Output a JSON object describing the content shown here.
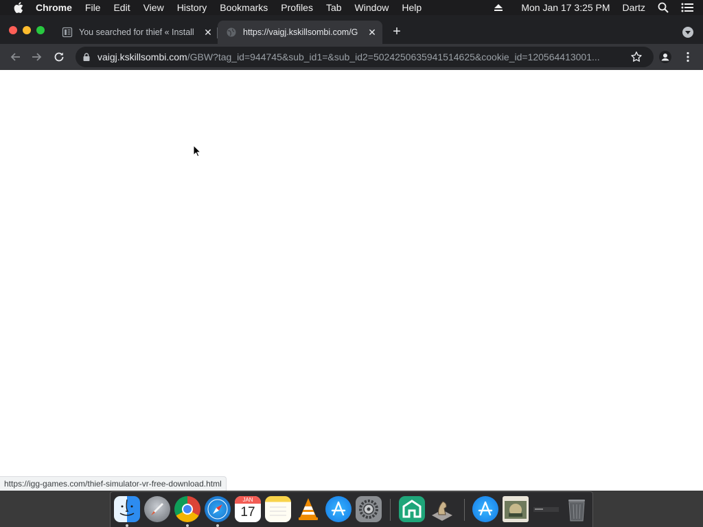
{
  "menubar": {
    "app_name": "Chrome",
    "items": [
      "File",
      "Edit",
      "View",
      "History",
      "Bookmarks",
      "Profiles",
      "Tab",
      "Window",
      "Help"
    ],
    "datetime": "Mon Jan 17  3:25 PM",
    "user": "Dartz"
  },
  "tabs": [
    {
      "title": "You searched for thief « Install",
      "active": false,
      "favicon": "page-icon"
    },
    {
      "title": "https://vaigj.kskillsombi.com/G",
      "active": true,
      "favicon": "globe-icon"
    }
  ],
  "toolbar": {
    "url_host": "vaigj.kskillsombi.com",
    "url_path": "/GBW?tag_id=944745&sub_id1=&sub_id2=5024250635941514625&cookie_id=120564413001..."
  },
  "status_bar": {
    "link": "https://igg-games.com/thief-simulator-vr-free-download.html"
  },
  "dock": {
    "apps": [
      "finder-icon",
      "launchpad-icon",
      "chrome-icon",
      "safari-icon",
      "calendar-icon",
      "notes-icon",
      "vlc-icon",
      "app-store-icon",
      "system-preferences-icon",
      "home-app-icon",
      "chess-icon",
      "app-store-2-icon",
      "photo-icon",
      "minimized-window-icon",
      "trash-icon"
    ],
    "calendar_month": "JAN",
    "calendar_day": "17"
  },
  "colors": {
    "menubar": "#1c1c1e",
    "tabstrip": "#202124",
    "toolbar": "#35363a",
    "page": "#ffffff"
  }
}
